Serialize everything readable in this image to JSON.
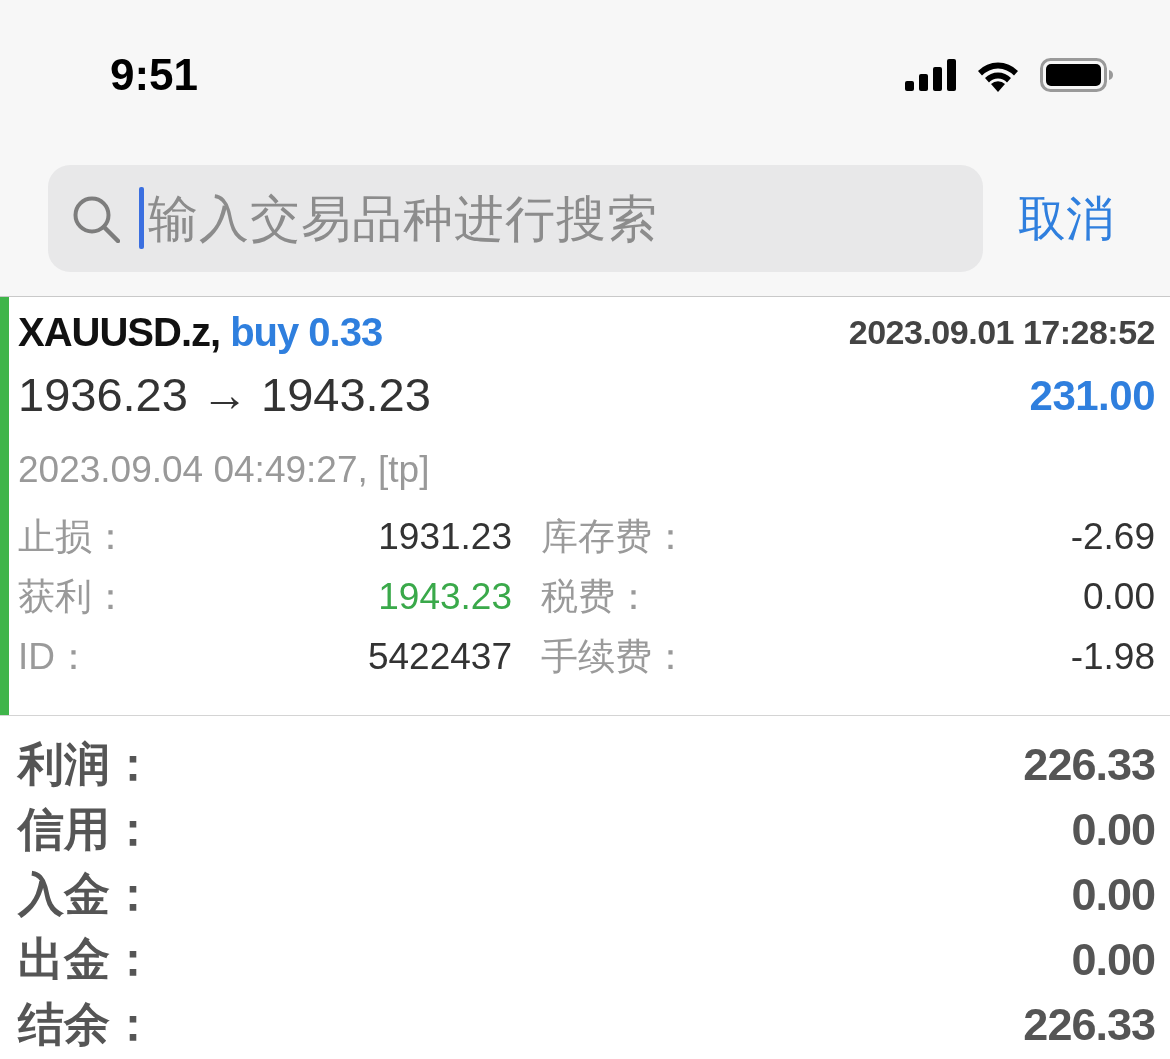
{
  "status_bar": {
    "time": "9:51"
  },
  "search": {
    "placeholder": "输入交易品种进行搜索",
    "focused": true,
    "cancel": "取消"
  },
  "trades": [
    {
      "color": "#3fb54a",
      "symbol": "XAUUSD.z,",
      "order": "buy 0.33",
      "open_time": "2023.09.01 17:28:52",
      "prices": "1936.23 → 1943.23",
      "profit": "231.00",
      "close_info": "2023.09.04 04:49:27, [tp]",
      "details": [
        {
          "label": "止损：",
          "value": "1931.23",
          "triggered": false
        },
        {
          "label": "库存费：",
          "value": "-2.69",
          "triggered": false
        },
        {
          "label": "获利：",
          "value": "1943.23",
          "triggered": true
        },
        {
          "label": "税费：",
          "value": "0.00",
          "triggered": false
        },
        {
          "label": "ID：",
          "value": "5422437",
          "triggered": false
        },
        {
          "label": "手续费：",
          "value": "-1.98",
          "triggered": false
        }
      ]
    }
  ],
  "summary": [
    {
      "label": "利润：",
      "value": "226.33"
    },
    {
      "label": "信用：",
      "value": "0.00"
    },
    {
      "label": "入金：",
      "value": "0.00"
    },
    {
      "label": "出金：",
      "value": "0.00"
    },
    {
      "label": "结余：",
      "value": "226.33"
    }
  ]
}
